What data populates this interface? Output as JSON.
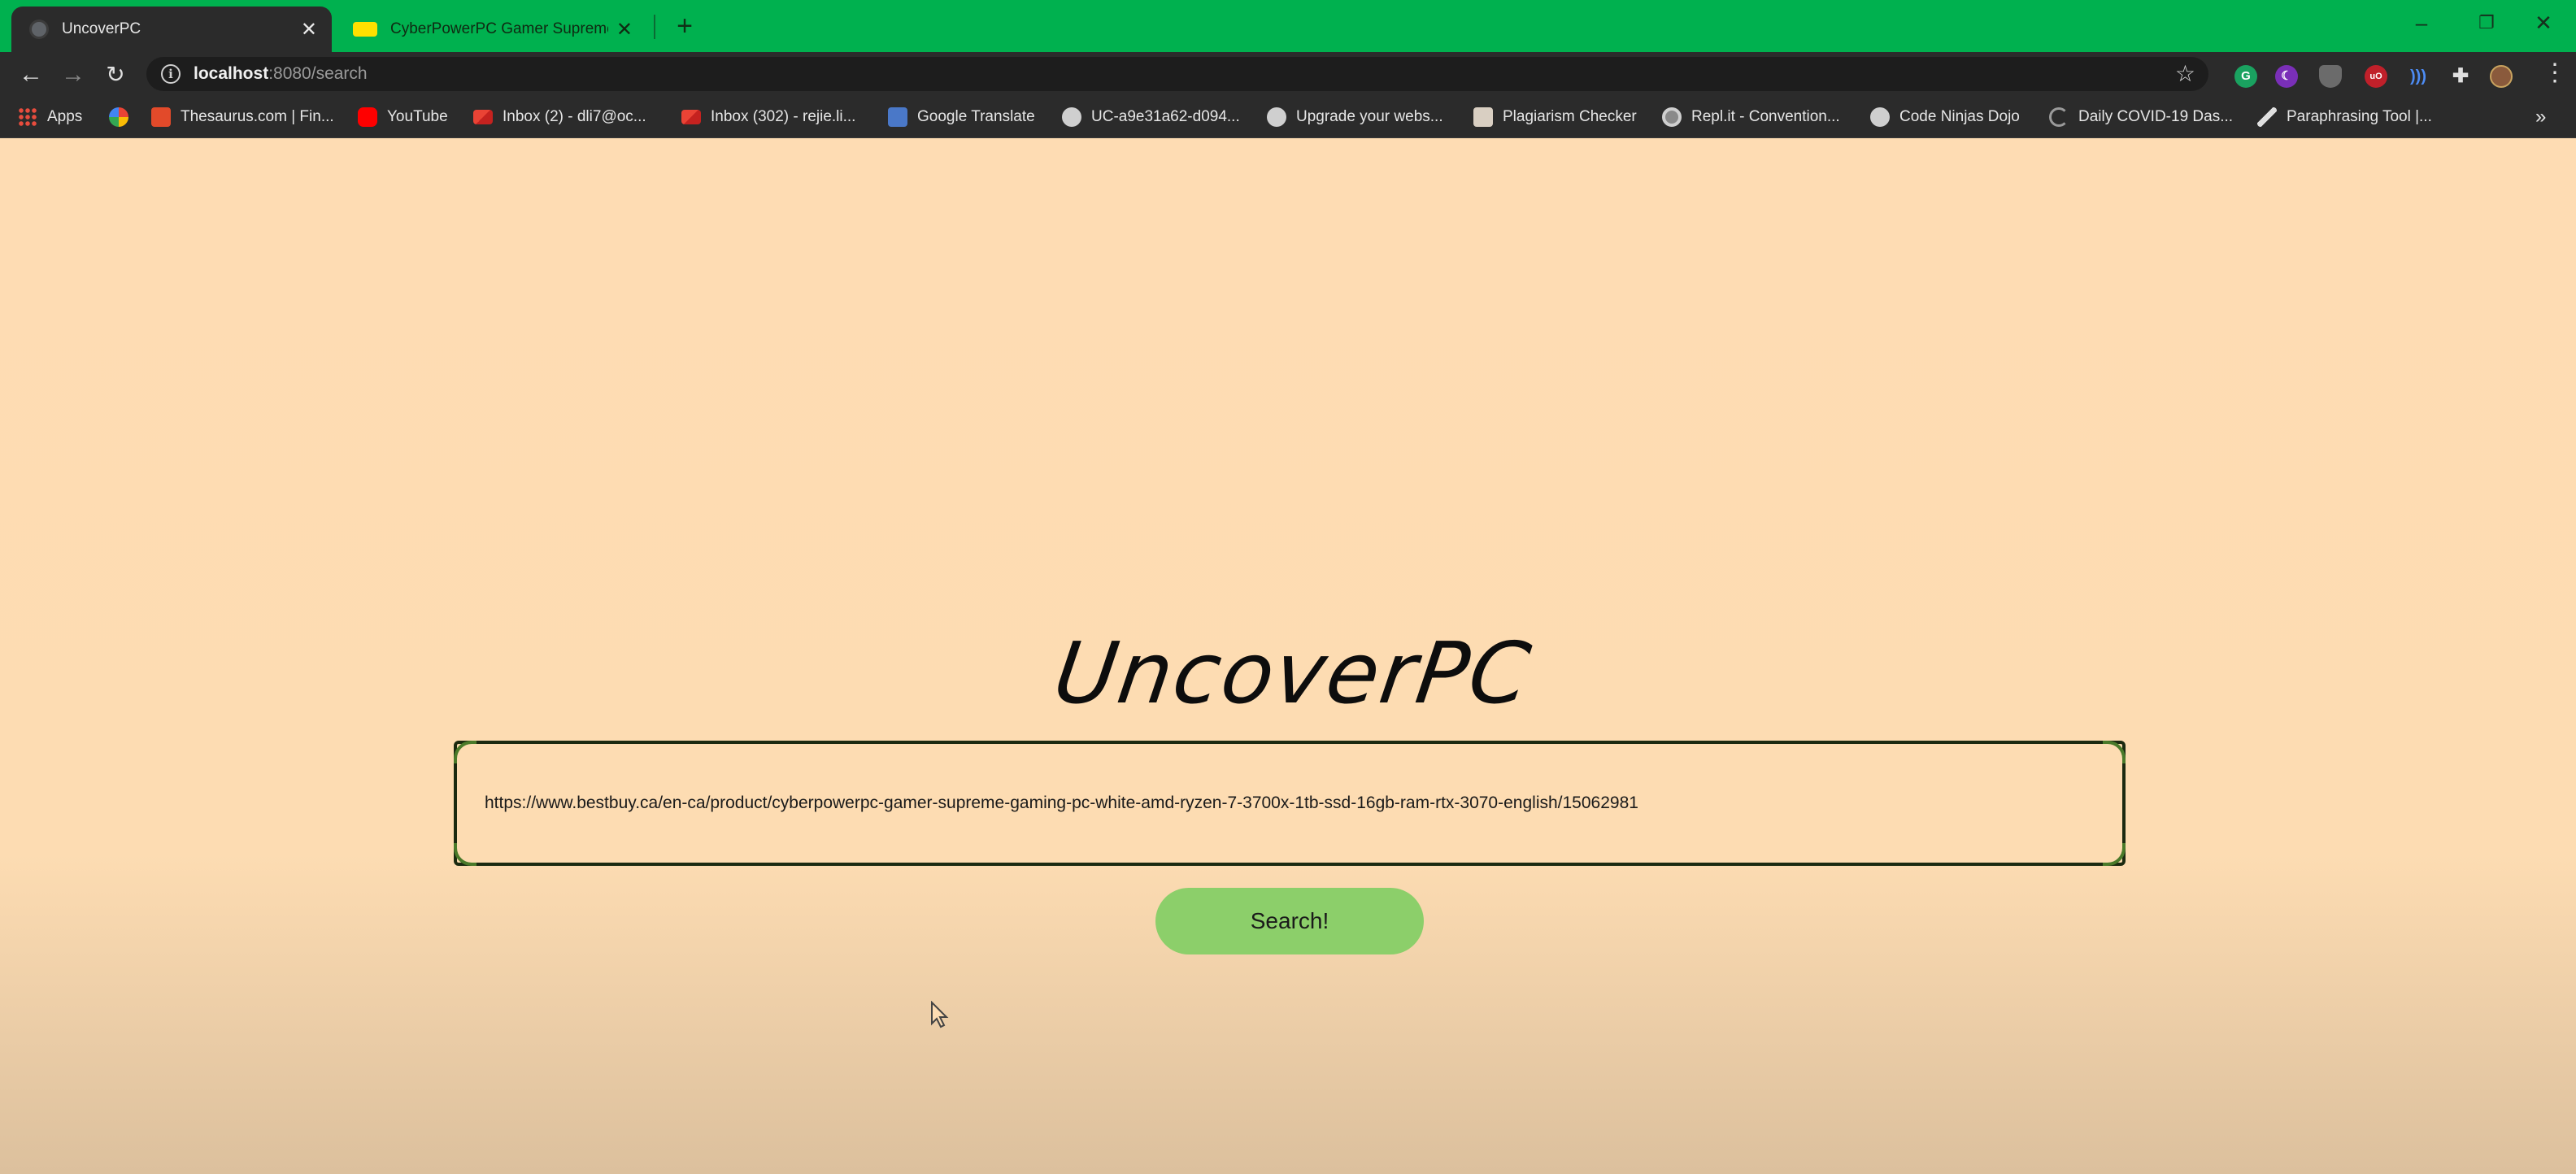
{
  "browser": {
    "tabs": [
      {
        "title": "UncoverPC",
        "active": true
      },
      {
        "title": "CyberPowerPC Gamer Supreme",
        "active": false
      }
    ],
    "new_tab_label": "+",
    "window_controls": {
      "minimize": "–",
      "restore": "❐",
      "close": "✕"
    },
    "address_bar": {
      "host": "localhost",
      "rest": ":8080/search"
    },
    "bookmarks": [
      {
        "label": "Apps",
        "icon": "apps-grid-icon"
      },
      {
        "label": "",
        "icon": "pinwheel-icon"
      },
      {
        "label": "Thesaurus.com | Fin...",
        "icon": "thesaurus-icon"
      },
      {
        "label": "YouTube",
        "icon": "youtube-icon"
      },
      {
        "label": "Inbox (2) - dli7@oc...",
        "icon": "gmail-icon"
      },
      {
        "label": "Inbox (302) - rejie.li...",
        "icon": "gmail-icon"
      },
      {
        "label": "Google Translate",
        "icon": "translate-icon"
      },
      {
        "label": "UC-a9e31a62-d094...",
        "icon": "globe-icon"
      },
      {
        "label": "Upgrade your webs...",
        "icon": "globe-icon"
      },
      {
        "label": "Plagiarism Checker",
        "icon": "plagiarism-icon"
      },
      {
        "label": "Repl.it - Convention...",
        "icon": "replit-icon"
      },
      {
        "label": "Code Ninjas Dojo",
        "icon": "globe-icon"
      },
      {
        "label": "Daily COVID-19 Das...",
        "icon": "covid-icon"
      },
      {
        "label": "Paraphrasing Tool |...",
        "icon": "pen-icon"
      }
    ],
    "bookmarks_overflow": "»"
  },
  "page": {
    "logo_text": "UncoverPC",
    "search_value": "https://www.bestbuy.ca/en-ca/product/cyberpowerpc-gamer-supreme-gaming-pc-white-amd-ryzen-7-3700x-1tb-ssd-16gb-ram-rtx-3070-english/15062981",
    "search_button_label": "Search!"
  },
  "colors": {
    "tab_strip": "#00b14f",
    "page_background": "#fddcb2",
    "search_button": "#8ccf6a"
  }
}
